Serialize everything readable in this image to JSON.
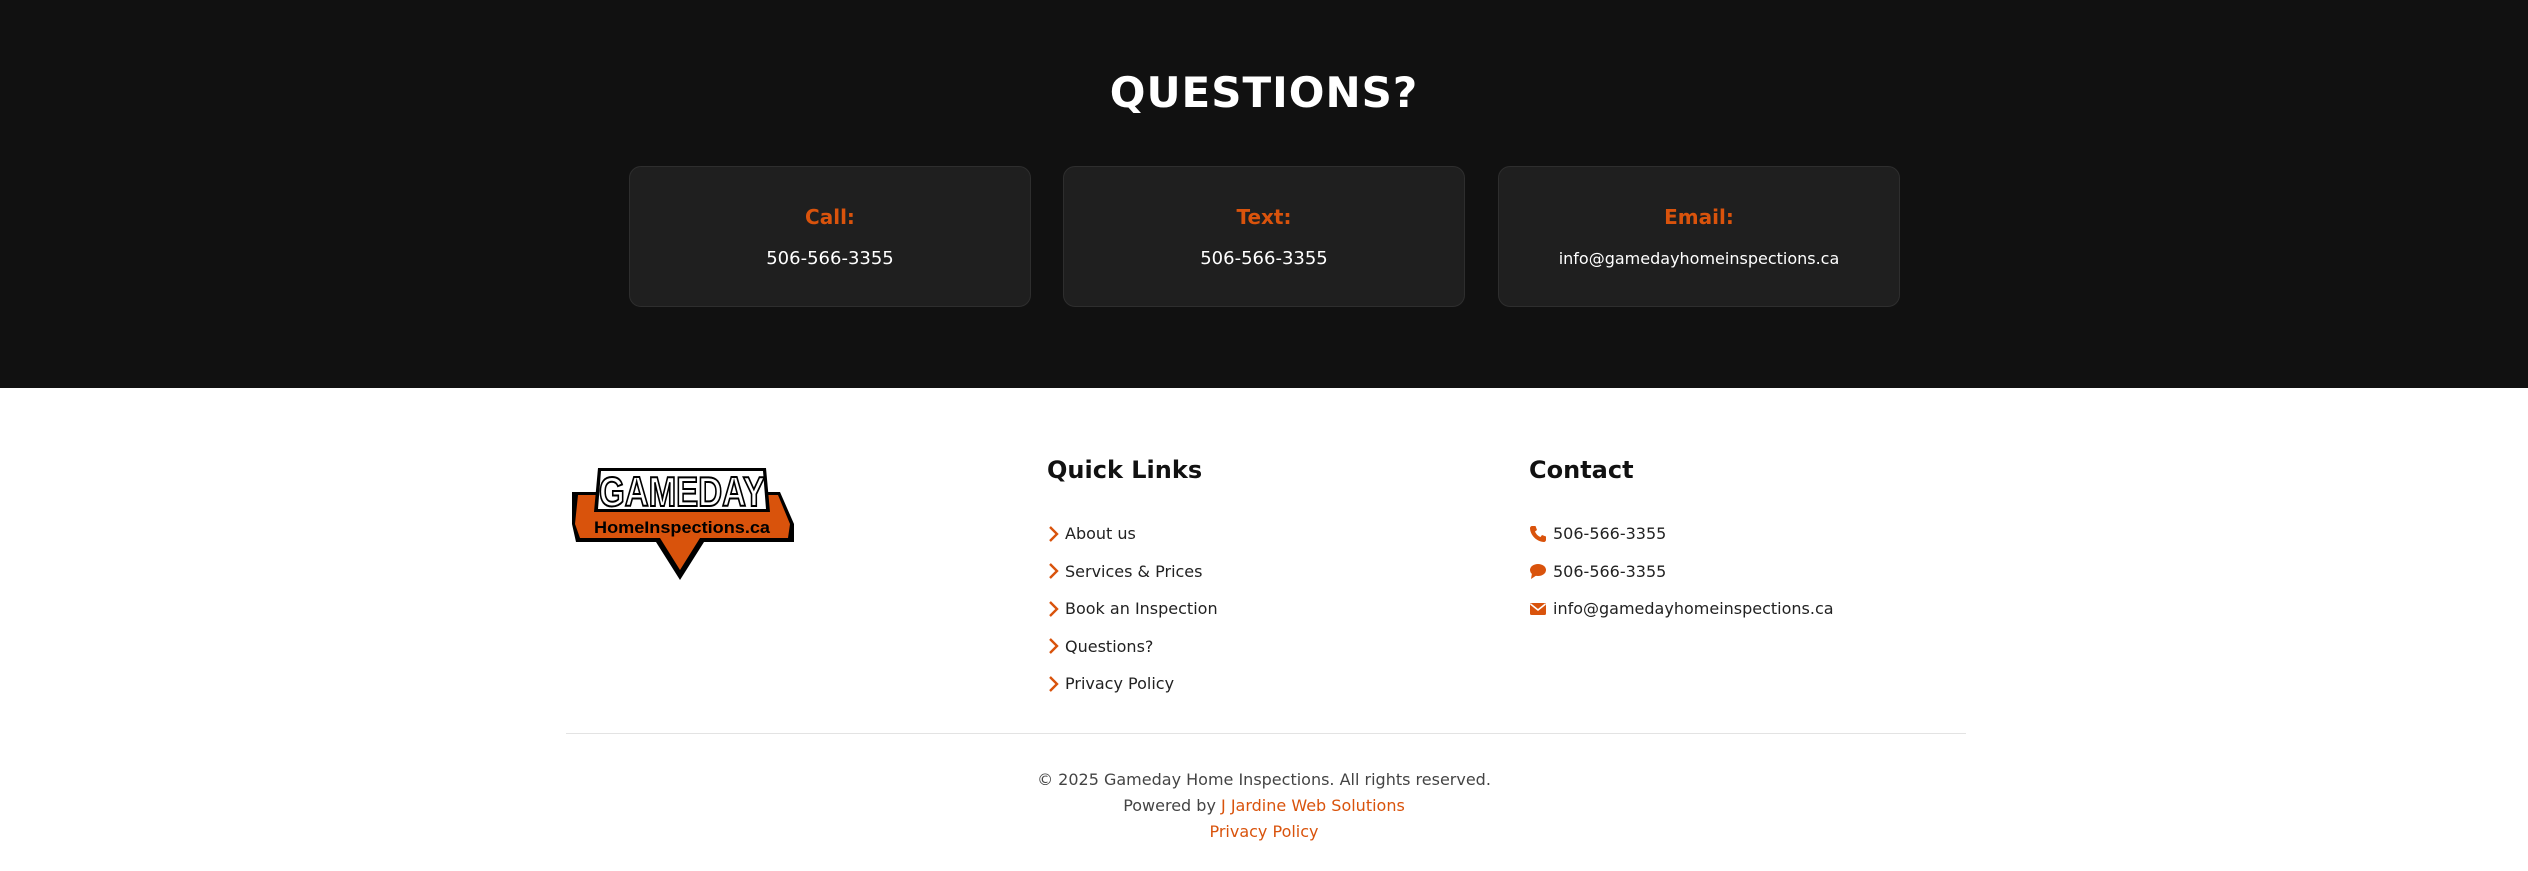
{
  "questions": {
    "title": "QUESTIONS?",
    "cards": [
      {
        "label": "Call:",
        "value": "506-566-3355"
      },
      {
        "label": "Text:",
        "value": "506-566-3355"
      },
      {
        "label": "Email:",
        "value": "info@gamedayhomeinspections.ca"
      }
    ]
  },
  "logo": {
    "line1": "GAMEDAY",
    "line2": "HomeInspections.ca"
  },
  "quick_links": {
    "title": "Quick Links",
    "items": [
      {
        "label": "About us",
        "icon": "chevron-right-icon"
      },
      {
        "label": "Services & Prices",
        "icon": "chevron-right-icon"
      },
      {
        "label": "Book an Inspection",
        "icon": "chevron-right-icon"
      },
      {
        "label": "Questions?",
        "icon": "chevron-right-icon"
      },
      {
        "label": "Privacy Policy",
        "icon": "chevron-right-icon"
      }
    ]
  },
  "contact": {
    "title": "Contact",
    "items": [
      {
        "label": "506-566-3355",
        "icon": "phone-icon"
      },
      {
        "label": "506-566-3355",
        "icon": "chat-bubble-icon"
      },
      {
        "label": "info@gamedayhomeinspections.ca",
        "icon": "envelope-icon"
      }
    ]
  },
  "footer": {
    "copyright": "© 2025 Gameday Home Inspections. All rights reserved.",
    "powered_prefix": "Powered by ",
    "powered_link": "J Jardine Web Solutions",
    "privacy_link": "Privacy Policy"
  },
  "colors": {
    "accent": "#d9530c",
    "dark_bg": "#111111",
    "card_bg": "#1f1f1f"
  }
}
